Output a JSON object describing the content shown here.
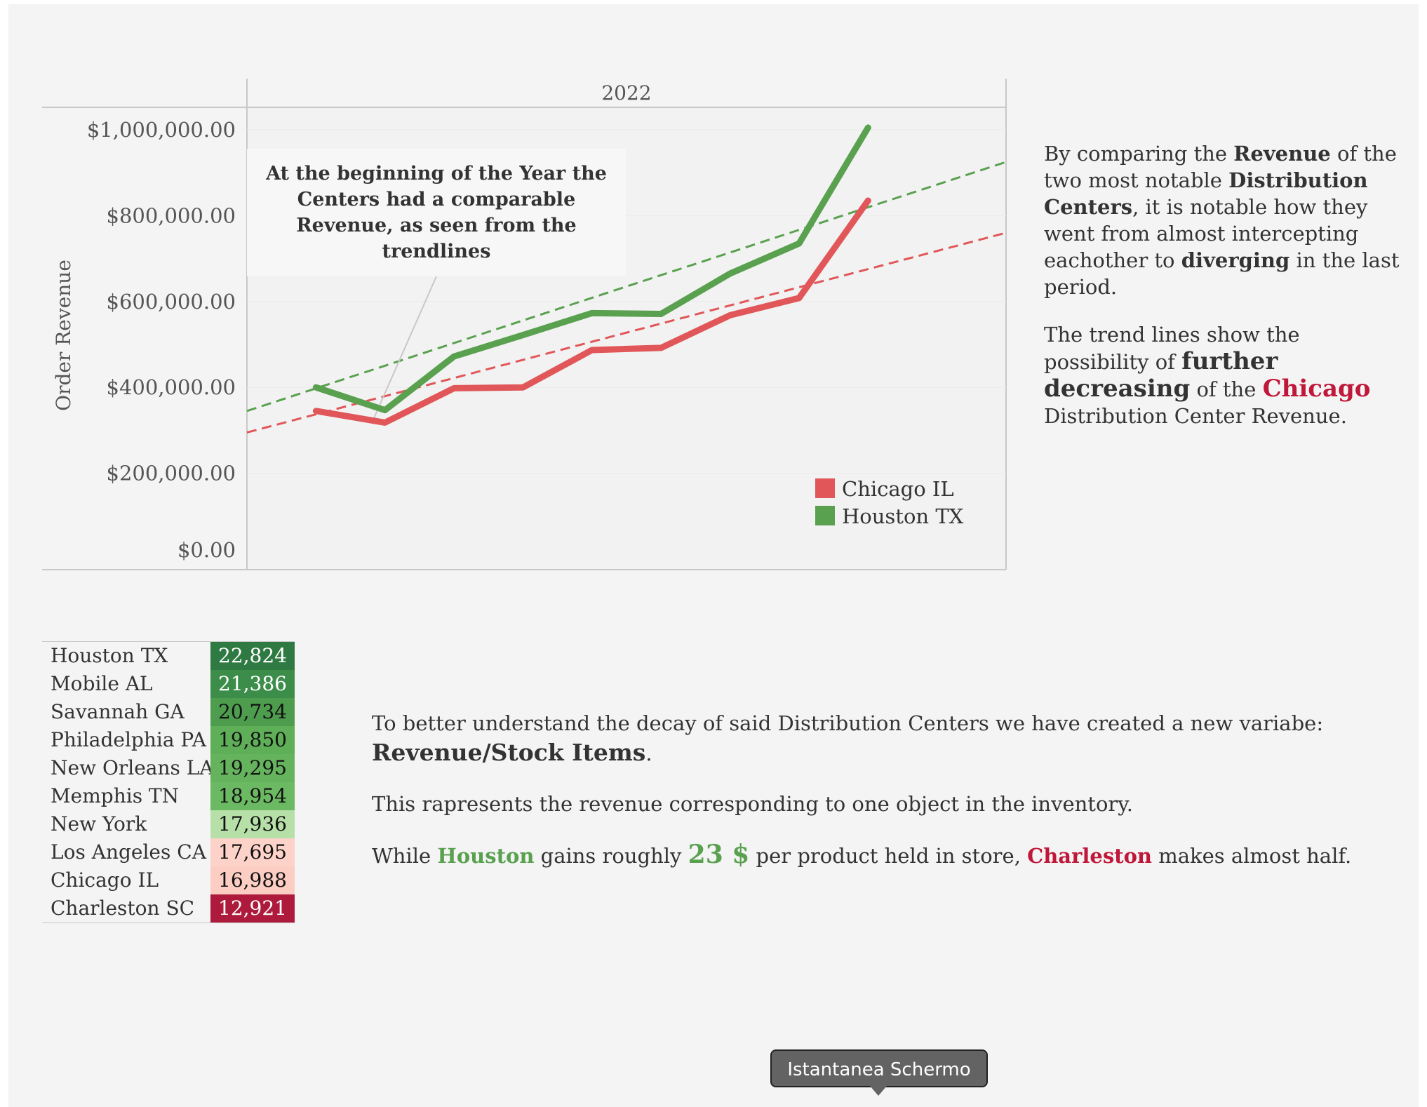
{
  "chart_data": {
    "type": "line",
    "column_header": "2022",
    "ylabel": "Order Revenue",
    "ylim": [
      0,
      1050000
    ],
    "y_ticks": [
      "$0.00",
      "$200,000.00",
      "$400,000.00",
      "$600,000.00",
      "$800,000.00",
      "$1,000,000.00"
    ],
    "y_tick_values": [
      0,
      200000,
      400000,
      600000,
      800000,
      1000000
    ],
    "x": [
      1,
      2,
      3,
      4,
      5,
      6,
      7,
      8,
      9,
      10,
      11,
      12
    ],
    "series": [
      {
        "name": "Chicago IL",
        "color": "#e15759",
        "values": [
          null,
          345000,
          318000,
          398000,
          400000,
          487000,
          492000,
          568000,
          608000,
          835000
        ]
      },
      {
        "name": "Houston TX",
        "color": "#59a14f",
        "values": [
          null,
          400000,
          347000,
          472000,
          522000,
          573000,
          571000,
          665000,
          735000,
          1005000
        ]
      }
    ],
    "trendlines": [
      {
        "series": "Chicago IL",
        "color": "#e15759",
        "style": "dashed",
        "y_start": 295000,
        "y_end": 760000
      },
      {
        "series": "Houston TX",
        "color": "#59a14f",
        "style": "dashed",
        "y_start": 345000,
        "y_end": 925000
      }
    ],
    "legend_position": "bottom-right",
    "annotation": "At the beginning of the Year the Centers had a comparable Revenue, as seen from the trendlines"
  },
  "side_text": {
    "p1": [
      "By comparing the ",
      "Revenue",
      " of the two most notable ",
      "Distribution Centers",
      ", it is notable how they went from almost intercepting eachother to ",
      "diverging",
      " in the last period."
    ],
    "p2": [
      "The trend lines show the possibility of ",
      "further decreasing",
      " of the ",
      "Chicago",
      " Distribution Center Revenue."
    ]
  },
  "table": {
    "rows": [
      {
        "name": "Houston TX",
        "value": "22,824",
        "bg": "#2e7a42",
        "fg": "#ffffff"
      },
      {
        "name": "Mobile AL",
        "value": "21,386",
        "bg": "#3c8d4a",
        "fg": "#ffffff"
      },
      {
        "name": "Savannah GA",
        "value": "20,734",
        "bg": "#4e9d4f",
        "fg": "#111111"
      },
      {
        "name": "Philadelphia PA",
        "value": "19,850",
        "bg": "#5fae58",
        "fg": "#111111"
      },
      {
        "name": "New Orleans LA",
        "value": "19,295",
        "bg": "#66b35e",
        "fg": "#111111"
      },
      {
        "name": "Memphis TN",
        "value": "18,954",
        "bg": "#6cb963",
        "fg": "#111111"
      },
      {
        "name": "New York",
        "value": "17,936",
        "bg": "#b7e0a8",
        "fg": "#111111"
      },
      {
        "name": "Los Angeles CA",
        "value": "17,695",
        "bg": "#fdd2c9",
        "fg": "#111111"
      },
      {
        "name": "Chicago IL",
        "value": "16,988",
        "bg": "#fbcdc3",
        "fg": "#111111"
      },
      {
        "name": "Charleston SC",
        "value": "12,921",
        "bg": "#ad1a3c",
        "fg": "#ffffff"
      }
    ]
  },
  "bottom_text": {
    "p1": [
      "To better understand the decay of said Distribution Centers we have created a new variabe: ",
      "Revenue/Stock Items",
      "."
    ],
    "p2": "This rapresents the revenue corresponding to one object in the inventory.",
    "p3": [
      "While ",
      "Houston",
      " gains roughly ",
      "23 $",
      " per product held in store, ",
      "Charleston",
      " makes almost half."
    ]
  },
  "tooltip": {
    "label": "Istantanea Schermo"
  }
}
